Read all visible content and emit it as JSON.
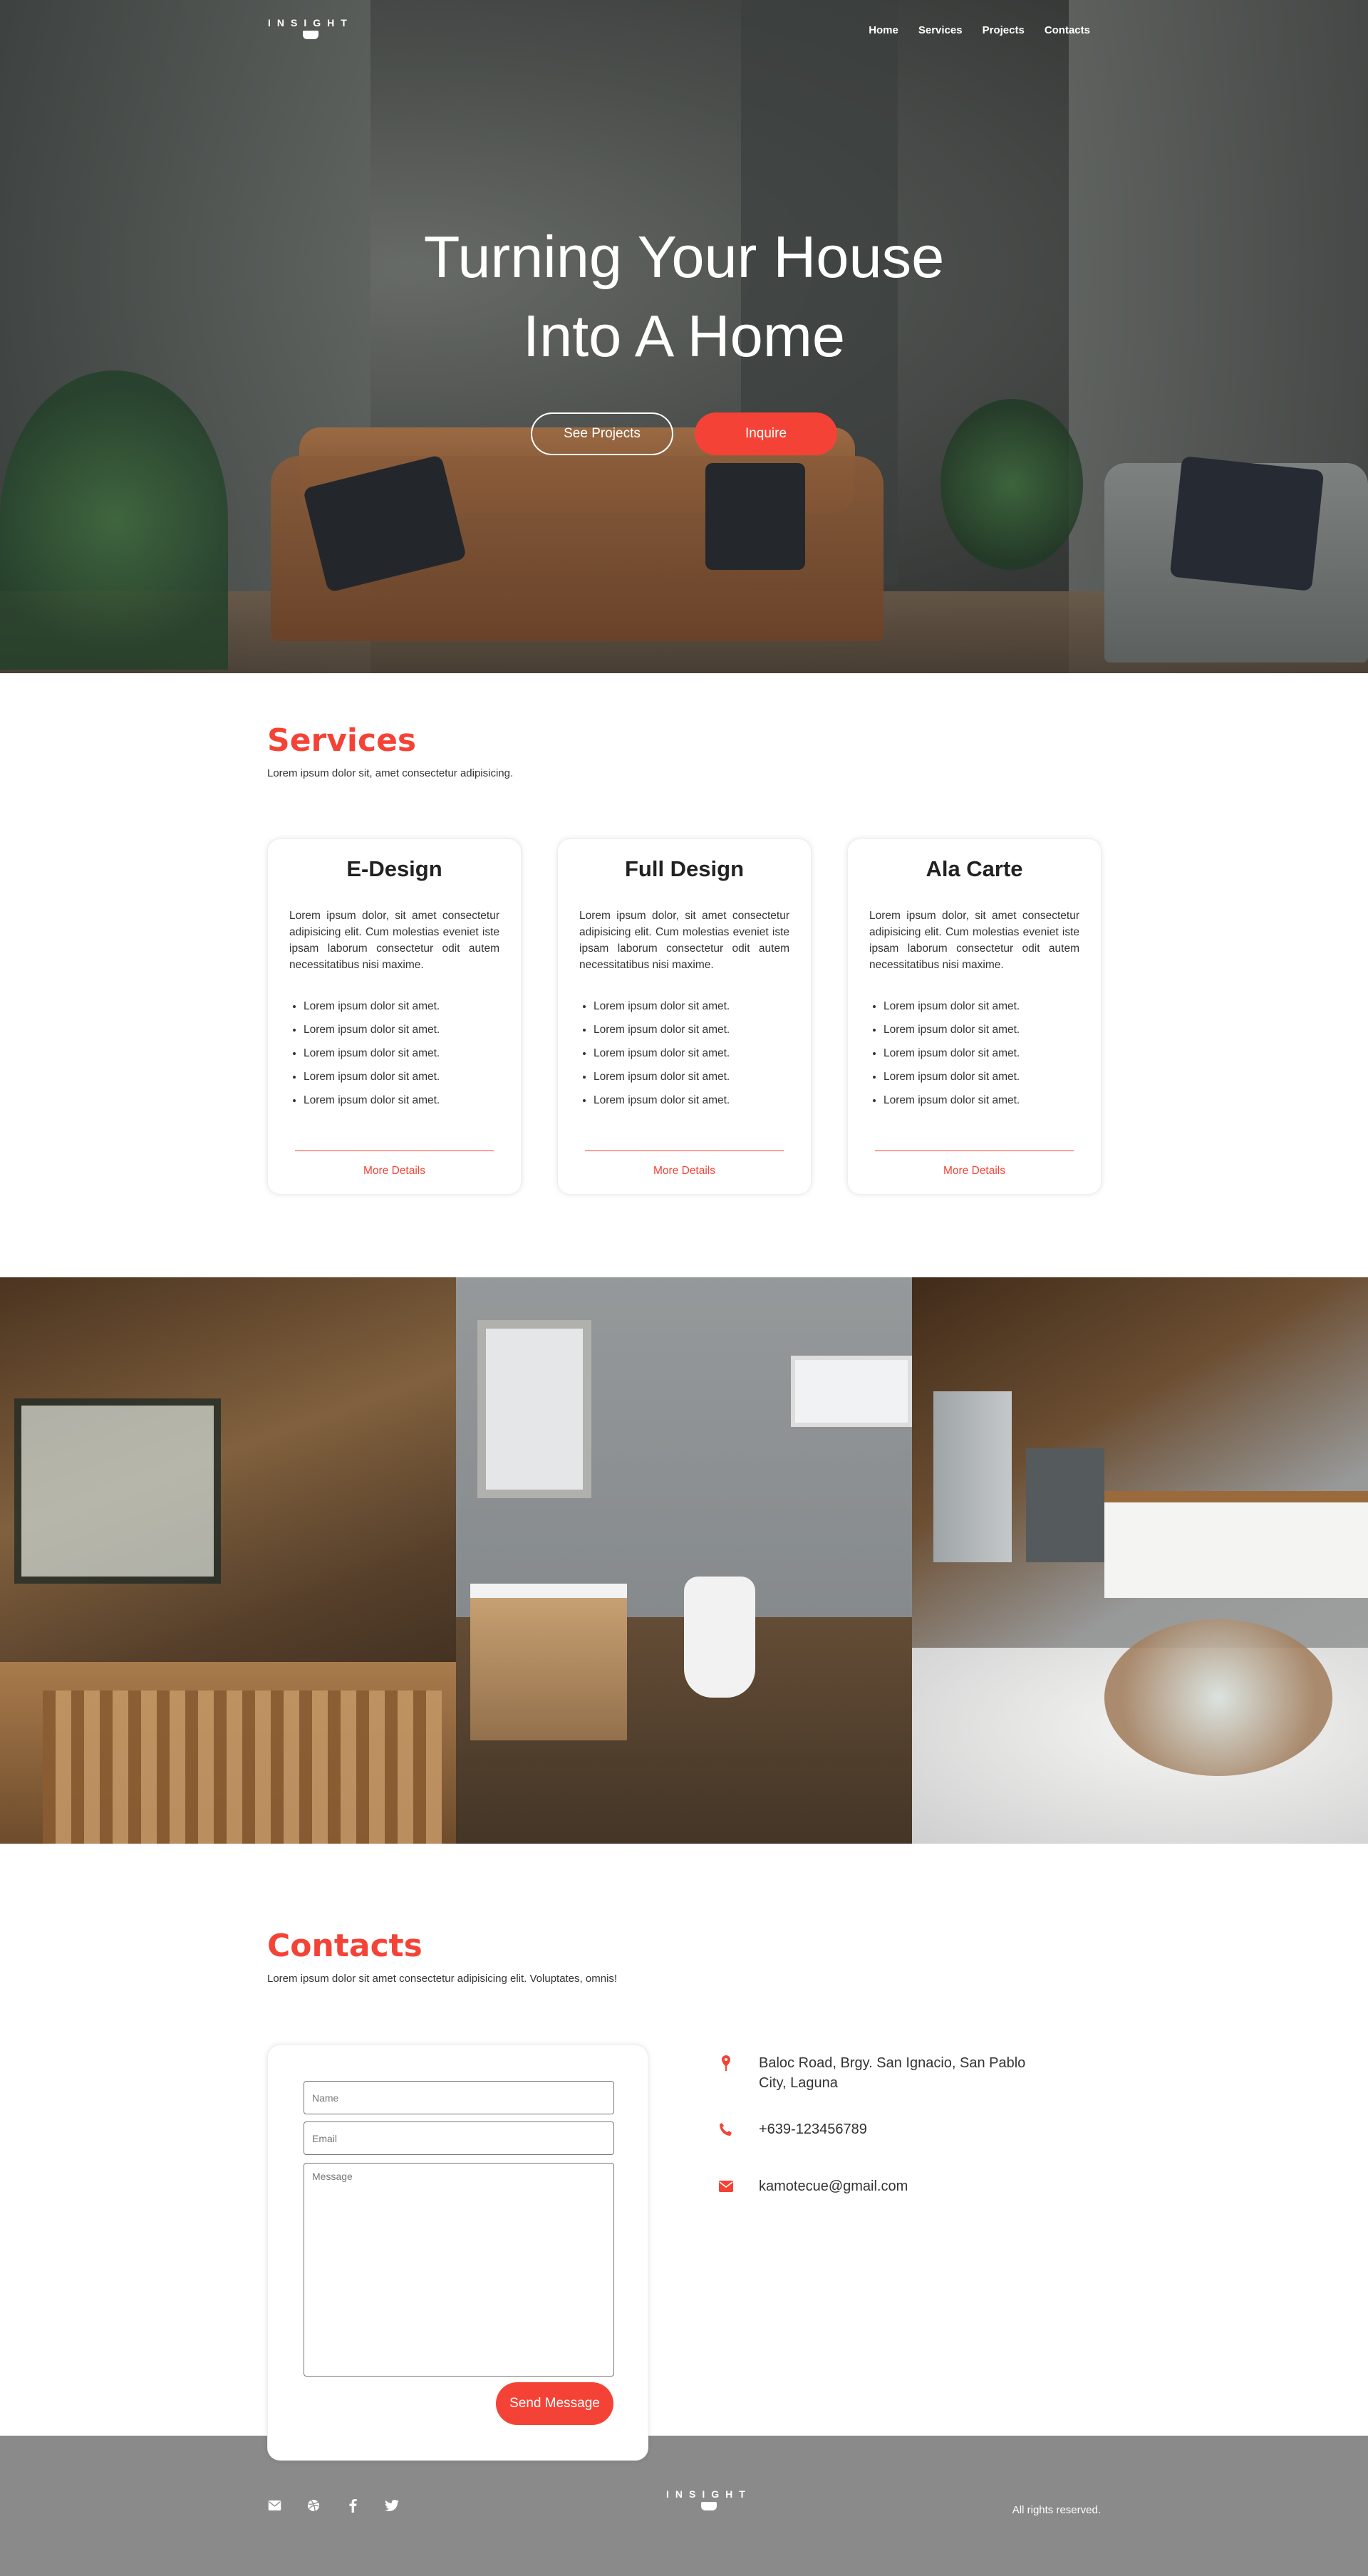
{
  "brand": {
    "logo_text": "INSIGHT"
  },
  "nav": {
    "items": [
      {
        "label": "Home"
      },
      {
        "label": "Services"
      },
      {
        "label": "Projects"
      },
      {
        "label": "Contacts"
      }
    ]
  },
  "hero": {
    "title_line1": "Turning Your House",
    "title_line2": "Into A Home",
    "btn_projects": "See Projects",
    "btn_inquire": "Inquire"
  },
  "services": {
    "title": "Services",
    "subtitle": "Lorem ipsum dolor sit, amet consectetur adipisicing.",
    "cards": [
      {
        "title": "E-Design",
        "description": "Lorem ipsum dolor, sit amet consectetur adipisicing elit. Cum molestias eveniet iste ipsam laborum consectetur odit autem necessitatibus nisi maxime.",
        "items": [
          "Lorem ipsum dolor sit amet.",
          "Lorem ipsum dolor sit amet.",
          "Lorem ipsum dolor sit amet.",
          "Lorem ipsum dolor sit amet.",
          "Lorem ipsum dolor sit amet."
        ],
        "link": "More Details"
      },
      {
        "title": "Full Design",
        "description": "Lorem ipsum dolor, sit amet consectetur adipisicing elit. Cum molestias eveniet iste ipsam laborum consectetur odit autem necessitatibus nisi maxime.",
        "items": [
          "Lorem ipsum dolor sit amet.",
          "Lorem ipsum dolor sit amet.",
          "Lorem ipsum dolor sit amet.",
          "Lorem ipsum dolor sit amet.",
          "Lorem ipsum dolor sit amet."
        ],
        "link": "More Details"
      },
      {
        "title": "Ala Carte",
        "description": "Lorem ipsum dolor, sit amet consectetur adipisicing elit. Cum molestias eveniet iste ipsam laborum consectetur odit autem necessitatibus nisi maxime.",
        "items": [
          "Lorem ipsum dolor sit amet.",
          "Lorem ipsum dolor sit amet.",
          "Lorem ipsum dolor sit amet.",
          "Lorem ipsum dolor sit amet.",
          "Lorem ipsum dolor sit amet."
        ],
        "link": "More Details"
      }
    ]
  },
  "gallery": {
    "images": [
      "kitchen-dining-photo",
      "bathroom-photo",
      "a-frame-kitchen-living-photo"
    ]
  },
  "contacts": {
    "title": "Contacts",
    "subtitle": "Lorem ipsum dolor sit amet consectetur adipisicing elit. Voluptates, omnis!",
    "form": {
      "name_placeholder": "Name",
      "email_placeholder": "Email",
      "message_placeholder": "Message",
      "send_label": "Send Message"
    },
    "info": [
      {
        "icon": "map-pin-icon",
        "text": "Baloc Road, Brgy. San Ignacio, San Pablo City, Laguna"
      },
      {
        "icon": "phone-icon",
        "text": "+639-123456789"
      },
      {
        "icon": "envelope-icon",
        "text": "kamotecue@gmail.com"
      }
    ]
  },
  "footer": {
    "icons": [
      "envelope-icon",
      "dribbble-icon",
      "facebook-icon",
      "twitter-icon"
    ],
    "rights": "All rights reserved."
  },
  "colors": {
    "accent": "#f44336",
    "footer_bg": "#8a8a8a"
  }
}
